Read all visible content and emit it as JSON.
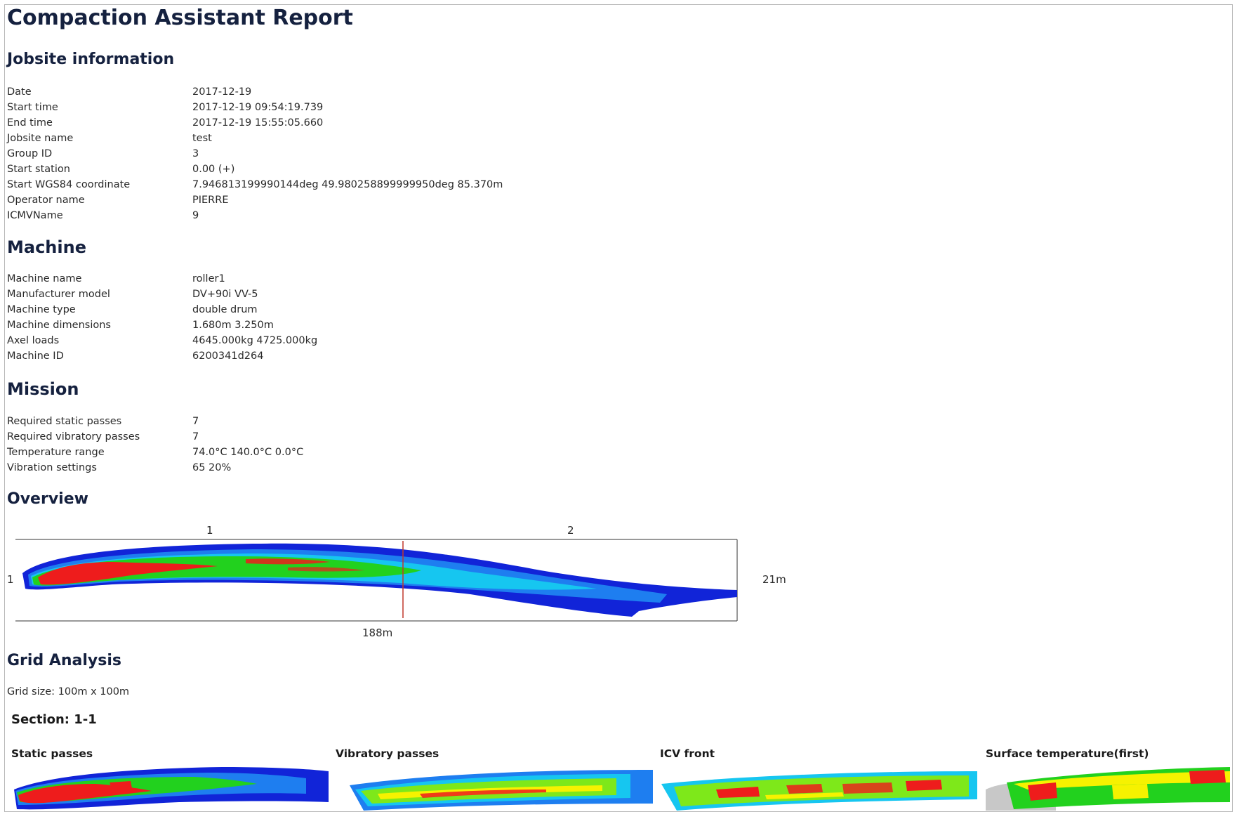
{
  "report_title": "Compaction Assistant Report",
  "jobsite": {
    "heading": "Jobsite information",
    "rows": [
      {
        "key": "Date",
        "value": "2017-12-19"
      },
      {
        "key": "Start time",
        "value": "2017-12-19 09:54:19.739"
      },
      {
        "key": "End time",
        "value": "2017-12-19 15:55:05.660"
      },
      {
        "key": "Jobsite name",
        "value": "test"
      },
      {
        "key": "Group ID",
        "value": "3"
      },
      {
        "key": "Start station",
        "value": "0.00 (+)"
      },
      {
        "key": "Start WGS84 coordinate",
        "value": "7.946813199990144deg 49.980258899999950deg 85.370m"
      },
      {
        "key": "Operator name",
        "value": "PIERRE"
      },
      {
        "key": "ICMVName",
        "value": "9"
      }
    ]
  },
  "machine": {
    "heading": "Machine",
    "rows": [
      {
        "key": "Machine name",
        "value": "roller1"
      },
      {
        "key": "Manufacturer model",
        "value": "DV+90i VV-5"
      },
      {
        "key": "Machine type",
        "value": "double drum"
      },
      {
        "key": "Machine dimensions",
        "value": "1.680m 3.250m"
      },
      {
        "key": "Axel loads",
        "value": "4645.000kg 4725.000kg"
      },
      {
        "key": "Machine ID",
        "value": "6200341d264"
      }
    ]
  },
  "mission": {
    "heading": "Mission",
    "rows": [
      {
        "key": "Required static passes",
        "value": "7"
      },
      {
        "key": "Required vibratory passes",
        "value": "7"
      },
      {
        "key": "Temperature range",
        "value": "74.0°C 140.0°C 0.0°C"
      },
      {
        "key": "Vibration settings",
        "value": "65 20%"
      }
    ]
  },
  "overview": {
    "heading": "Overview",
    "segment_labels": [
      "1",
      "2"
    ],
    "row_label": "1",
    "height_label": "21m",
    "length_label": "188m"
  },
  "grid_analysis": {
    "heading": "Grid Analysis",
    "grid_size_label": "Grid size:",
    "grid_size_value": "100m x 100m",
    "section_label": "Section:",
    "section_value": "1-1",
    "thumbnails": [
      {
        "title": "Static passes"
      },
      {
        "title": "Vibratory passes"
      },
      {
        "title": "ICV front"
      },
      {
        "title": "Surface temperature(first)"
      }
    ]
  },
  "colors": {
    "heading": "#15213f",
    "red": "#ee1c1c",
    "green": "#22d11e",
    "light_green": "#7ee81a",
    "yellow": "#f6f200",
    "cyan": "#16c6f0",
    "blue_mid": "#1e7ef0",
    "blue_dark": "#1124d8",
    "grey": "#c8c8c8",
    "divider": "#c0392b"
  }
}
